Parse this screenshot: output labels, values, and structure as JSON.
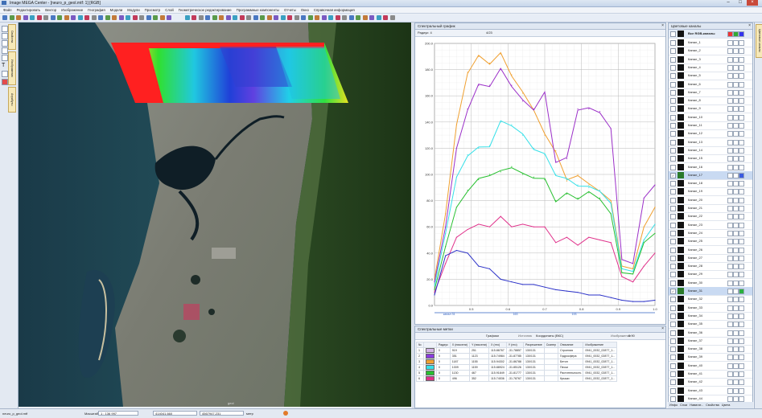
{
  "window": {
    "title": "Image MEGA Center - [neuro_p_geol.mtf: 1] [RGB]"
  },
  "menu": [
    "Файл",
    "Редактировать",
    "Вектор",
    "Изображение",
    "География",
    "Модели",
    "Модули",
    "Просмотр",
    "Слой",
    "Геометрическое редактирование",
    "Программные компоненты",
    "Отчеты",
    "Окно",
    "Справочная информация"
  ],
  "left_tabs": [
    "Свойства",
    "Изображения",
    "Атрибуты"
  ],
  "chart": {
    "panel_title": "Спектральный график",
    "sel_value": "Радиус: 4",
    "field_value": "4/23",
    "series_colors": [
      "#f0a030",
      "#9b2fc8",
      "#35e0e8",
      "#28c030",
      "#e0308a",
      "#2a30c8"
    ]
  },
  "chart_data": {
    "type": "line",
    "title": "",
    "xlabel": "",
    "ylabel": "",
    "ylim": [
      0,
      200
    ],
    "xlim": [
      0.4,
      1.0
    ],
    "y_ticks": [
      "0.0",
      "20.0",
      "40.0",
      "60.0",
      "80.0",
      "100.0",
      "120.0",
      "140.0",
      "160.0",
      "180.0",
      "200.0"
    ],
    "x_ticks": [
      "0.5",
      "0.6",
      "0.7",
      "0.8",
      "0.9",
      "1.0"
    ],
    "band_labels": [
      "канал 31",
      "163",
      "193"
    ],
    "x": [
      0.4,
      0.43,
      0.46,
      0.49,
      0.52,
      0.55,
      0.58,
      0.61,
      0.64,
      0.67,
      0.7,
      0.73,
      0.76,
      0.79,
      0.82,
      0.85,
      0.88,
      0.91,
      0.94,
      0.97,
      1.0
    ],
    "series": [
      {
        "name": "Строения",
        "color": "#f0a030",
        "values": [
          20,
          70,
          138,
          178,
          190,
          185,
          192,
          176,
          162,
          150,
          130,
          118,
          95,
          100,
          92,
          88,
          80,
          30,
          28,
          60,
          75
        ]
      },
      {
        "name": "Гидросфера",
        "color": "#9b2fc8",
        "values": [
          18,
          60,
          120,
          150,
          168,
          168,
          180,
          168,
          156,
          150,
          162,
          110,
          112,
          150,
          150,
          148,
          135,
          35,
          32,
          82,
          92
        ]
      },
      {
        "name": "Бетон",
        "color": "#35e0e8",
        "values": [
          15,
          55,
          98,
          115,
          120,
          122,
          140,
          138,
          130,
          120,
          115,
          100,
          96,
          92,
          90,
          88,
          78,
          28,
          26,
          50,
          62
        ]
      },
      {
        "name": "Пески",
        "color": "#28c030",
        "values": [
          12,
          45,
          75,
          88,
          96,
          100,
          102,
          106,
          100,
          98,
          96,
          80,
          85,
          82,
          86,
          82,
          70,
          25,
          24,
          48,
          55
        ]
      },
      {
        "name": "Растительность",
        "color": "#e0308a",
        "values": [
          10,
          32,
          52,
          58,
          62,
          60,
          68,
          60,
          62,
          60,
          60,
          48,
          52,
          46,
          52,
          50,
          48,
          22,
          18,
          30,
          40
        ]
      },
      {
        "name": "Крыши",
        "color": "#2a30c8",
        "values": [
          8,
          38,
          42,
          40,
          30,
          28,
          20,
          18,
          16,
          16,
          14,
          12,
          11,
          10,
          8,
          8,
          6,
          4,
          3,
          3,
          4
        ]
      }
    ]
  },
  "table": {
    "panel_title": "Спектральные метки",
    "toolbar_graph": "Графики",
    "toolbar_coords_label": "Источник",
    "toolbar_coords": "Координаты (ВКС)",
    "toolbar_image_label": "Изображение",
    "toolbar_image_value": "0.90",
    "columns": [
      "№",
      "",
      "Радиус",
      "X (пиксели)",
      "Y (пиксели)",
      "X (гео)",
      "Y (гео)",
      "Разрешение",
      "Сканер",
      "Описание",
      "Изображение"
    ],
    "rows": [
      [
        "0",
        "919",
        "251",
        "115.86767",
        "-31.78857",
        "130/131",
        "",
        "Строения",
        "0941_0032_02877_1..."
      ],
      [
        "0",
        "351",
        "1123",
        "115.74984",
        "-31.87785",
        "130/131",
        "",
        "Гидросфера",
        "0941_0032_02877_1..."
      ],
      [
        "0",
        "1187",
        "1155",
        "115.94302",
        "-31.86788",
        "130/131",
        "",
        "Бетон",
        "0941_0032_02877_1..."
      ],
      [
        "0",
        "1009",
        "1159",
        "115.88924",
        "-31.85126",
        "130/131",
        "",
        "Пески",
        "0941_0032_02877_1..."
      ],
      [
        "0",
        "1130",
        "467",
        "115.91849",
        "-31.81777",
        "130/131",
        "",
        "Растительность",
        "0941_0032_02877_1..."
      ],
      [
        "0",
        "496",
        "352",
        "115.74536",
        "-31.78767",
        "130/131",
        "",
        "Крыши",
        "0941_0032_02877_1..."
      ]
    ],
    "row_colors": [
      "#d5b3e8",
      "#8a3be0",
      "#f0a030",
      "#35e0e8",
      "#28c030",
      "#e0308a"
    ],
    "row_ids": [
      "1",
      "2",
      "3",
      "4",
      "5",
      "6"
    ]
  },
  "channels": {
    "panel_title": "Цветовые каналы",
    "header": "Все RGB-каналы",
    "items": [
      "Канал_1",
      "Канал_2",
      "Канал_3",
      "Канал_4",
      "Канал_5",
      "Канал_6",
      "Канал_7",
      "Канал_8",
      "Канал_9",
      "Канал_10",
      "Канал_11",
      "Канал_12",
      "Канал_13",
      "Канал_14",
      "Канал_15",
      "Канал_16",
      "Канал_17",
      "Канал_18",
      "Канал_19",
      "Канал_20",
      "Канал_21",
      "Канал_22",
      "Канал_23",
      "Канал_24",
      "Канал_25",
      "Канал_26",
      "Канал_27",
      "Канал_28",
      "Канал_29",
      "Канал_30",
      "Канал_31",
      "Канал_32",
      "Канал_33",
      "Канал_34",
      "Канал_35",
      "Канал_36",
      "Канал_37",
      "Канал_38",
      "Канал_39",
      "Канал_40",
      "Канал_41",
      "Канал_42",
      "Канал_43",
      "Канал_44"
    ],
    "selected": [
      "Канал_17",
      "Канал_31"
    ],
    "bottom_tabs": [
      "Инфо",
      "Слои",
      "Навигат...",
      "Свойства",
      "Цвета"
    ]
  },
  "status": {
    "file": "neuro_p_geol.mtf",
    "scale_label": "Масштаб",
    "scale_value": "1 : 136 997",
    "x_value": "414041.660",
    "y_value": "4567947.231",
    "units": "метр"
  },
  "map_labels": {
    "scan_label": "geol"
  }
}
